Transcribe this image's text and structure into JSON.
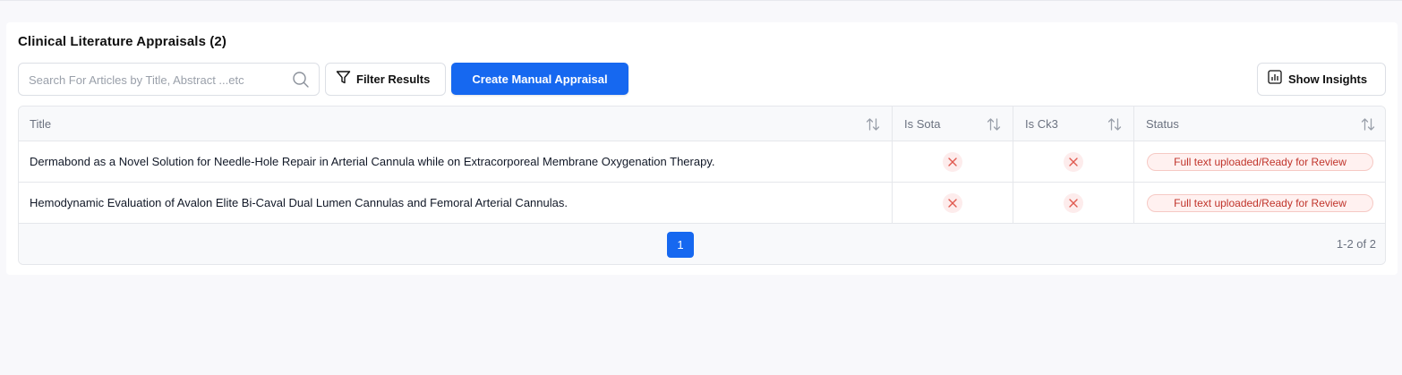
{
  "header": {
    "title": "Clinical Literature Appraisals (2)"
  },
  "toolbar": {
    "search_placeholder": "Search For Articles by Title, Abstract ...etc",
    "search_value": "",
    "filter_label": "Filter Results",
    "create_label": "Create Manual Appraisal",
    "insights_label": "Show Insights"
  },
  "table": {
    "columns": [
      "Title",
      "Is Sota",
      "Is Ck3",
      "Status"
    ],
    "rows": [
      {
        "title": "Dermabond as a Novel Solution for Needle-Hole Repair in Arterial Cannula while on Extracorporeal Membrane Oxygenation Therapy.",
        "is_sota": "close-icon",
        "is_ck3": "close-icon",
        "status": "Full text uploaded/Ready for Review"
      },
      {
        "title": "Hemodynamic Evaluation of Avalon Elite Bi-Caval Dual Lumen Cannulas and Femoral Arterial Cannulas.",
        "is_sota": "close-icon",
        "is_ck3": "close-icon",
        "status": "Full text uploaded/Ready for Review"
      }
    ]
  },
  "pagination": {
    "current_page": "1",
    "range_text": "1-2 of 2"
  },
  "colors": {
    "accent": "#1668f0",
    "status_text": "#c0342b",
    "status_bg": "#fff1f0",
    "x_icon": "#e0594f"
  }
}
